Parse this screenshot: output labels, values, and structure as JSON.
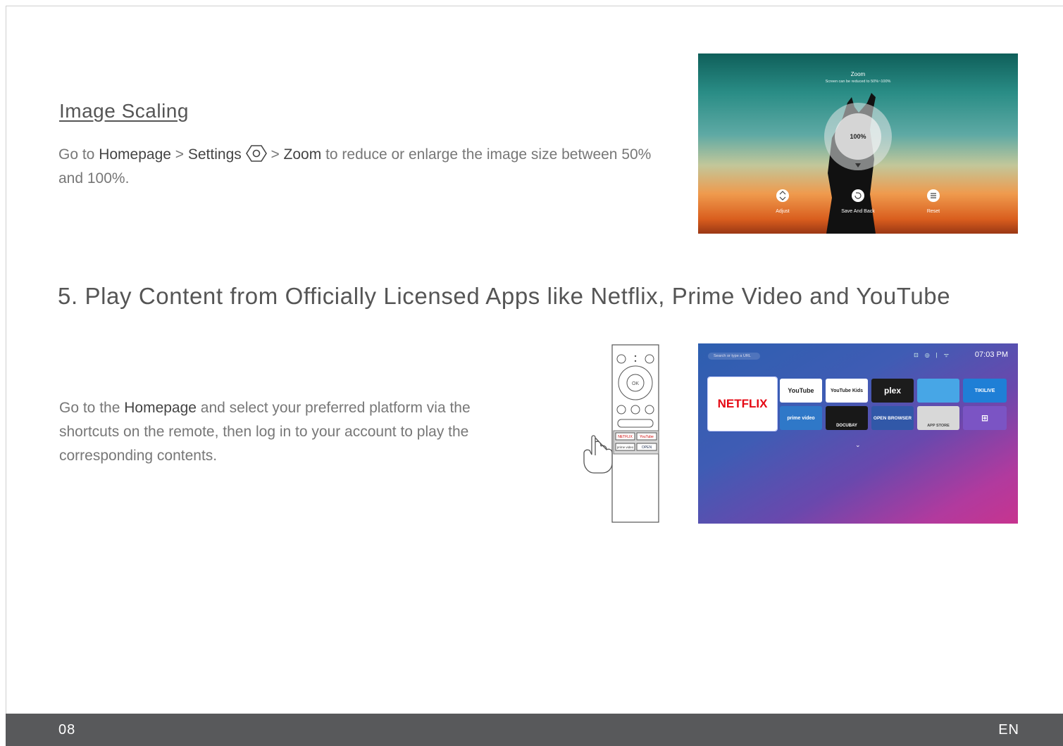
{
  "image_scaling": {
    "heading": "Image Scaling",
    "text_1": "Go to ",
    "homepage": "Homepage",
    "sep_1": " > ",
    "settings": "Settings",
    "sep_2": " > ",
    "zoom": "Zoom",
    "text_2": " to reduce or enlarge the image size between 50% and 100%.",
    "settings_icon": "gear-hexagon-icon"
  },
  "zoom_screen": {
    "title": "Zoom",
    "subtitle": "Screen can be reduced to 50%~100%",
    "value": "100%",
    "actions": [
      "Adjust",
      "Save And Back",
      "Reset"
    ]
  },
  "section5": {
    "heading": "5. Play Content from Officially Licensed Apps like Netflix, Prime Video and YouTube",
    "text_1": "Go to the ",
    "homepage": "Homepage",
    "text_2": " and select your preferred platform via the shortcuts on the remote, then log in to your account to play the corresponding contents."
  },
  "remote": {
    "ok_label": "OK",
    "shortcut_labels": [
      "NETFLIX",
      "YouTube",
      "prime video",
      "OPEN"
    ]
  },
  "tv_screen": {
    "search_placeholder": "Search or type a URL",
    "time": "07:03 PM",
    "apps": [
      "NETFLIX",
      "YouTube",
      "YouTube Kids",
      "plex",
      "TIKILIVE",
      "prime video",
      "DOCUBAY",
      "OPEN BROWSER",
      "APP STORE"
    ]
  },
  "footer": {
    "page_number": "08",
    "language": "EN"
  }
}
